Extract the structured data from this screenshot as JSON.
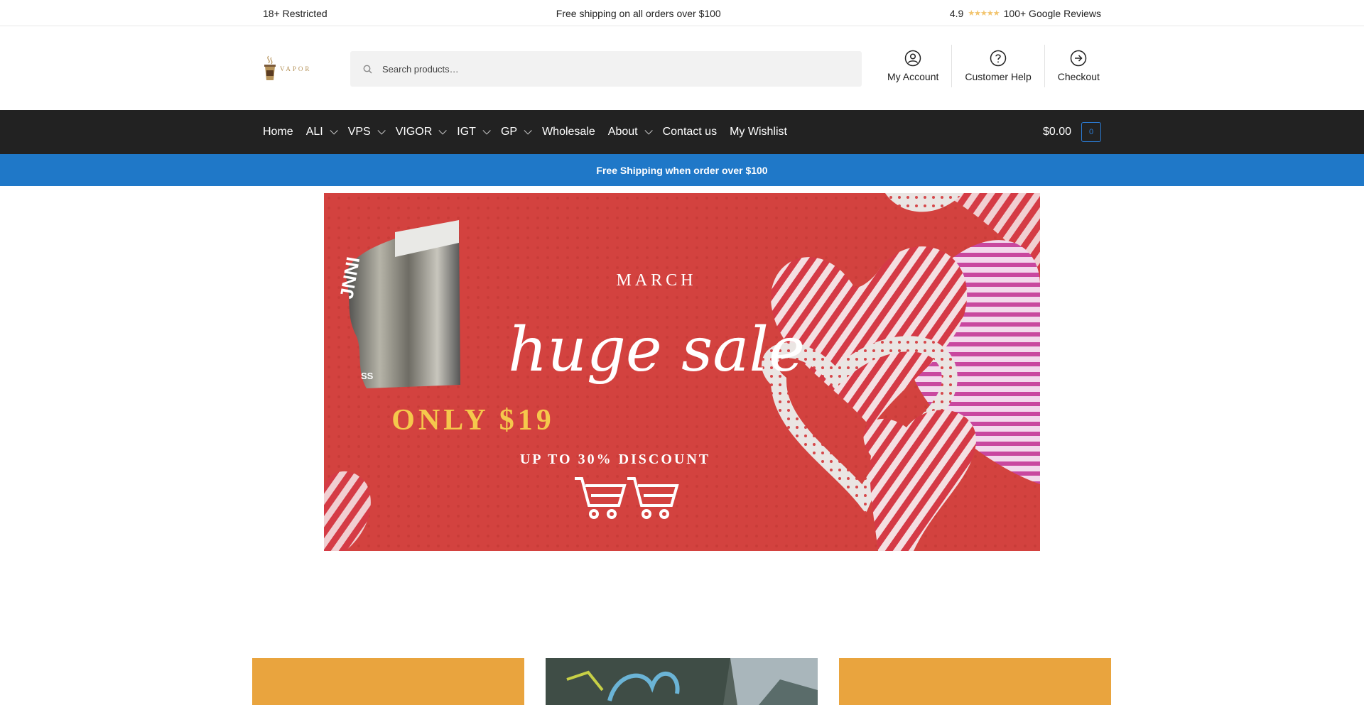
{
  "topbar": {
    "left": "18+ Restricted",
    "center": "Free shipping on all orders over $100",
    "rating": "4.9",
    "reviews": "100+ Google Reviews"
  },
  "logo": {
    "text": "VAPOR"
  },
  "search": {
    "placeholder": "Search products…"
  },
  "header_links": [
    {
      "label": "My Account",
      "icon": "user-circle-icon"
    },
    {
      "label": "Customer Help",
      "icon": "question-circle-icon"
    },
    {
      "label": "Checkout",
      "icon": "arrow-circle-icon"
    }
  ],
  "nav": {
    "items": [
      {
        "label": "Home",
        "dropdown": false
      },
      {
        "label": "ALI",
        "dropdown": true
      },
      {
        "label": "VPS",
        "dropdown": true
      },
      {
        "label": "VIGOR",
        "dropdown": true
      },
      {
        "label": "IGT",
        "dropdown": true
      },
      {
        "label": "GP",
        "dropdown": true
      },
      {
        "label": "Wholesale",
        "dropdown": false
      },
      {
        "label": "About",
        "dropdown": true
      },
      {
        "label": "Contact us",
        "dropdown": false
      },
      {
        "label": "My Wishlist",
        "dropdown": false
      }
    ],
    "cart_total": "$0.00",
    "cart_count": "0"
  },
  "promo": {
    "text": "Free Shipping when order over $100"
  },
  "banner": {
    "month": "MARCH",
    "headline": "huge sale",
    "price": "ONLY $19",
    "discount": "UP TO 30% DISCOUNT"
  },
  "colors": {
    "nav_bg": "#222222",
    "promo_bg": "#1f78c8",
    "banner_red": "#d3423f",
    "card_orange": "#e9a43e",
    "price_yellow": "#f5c84c"
  }
}
